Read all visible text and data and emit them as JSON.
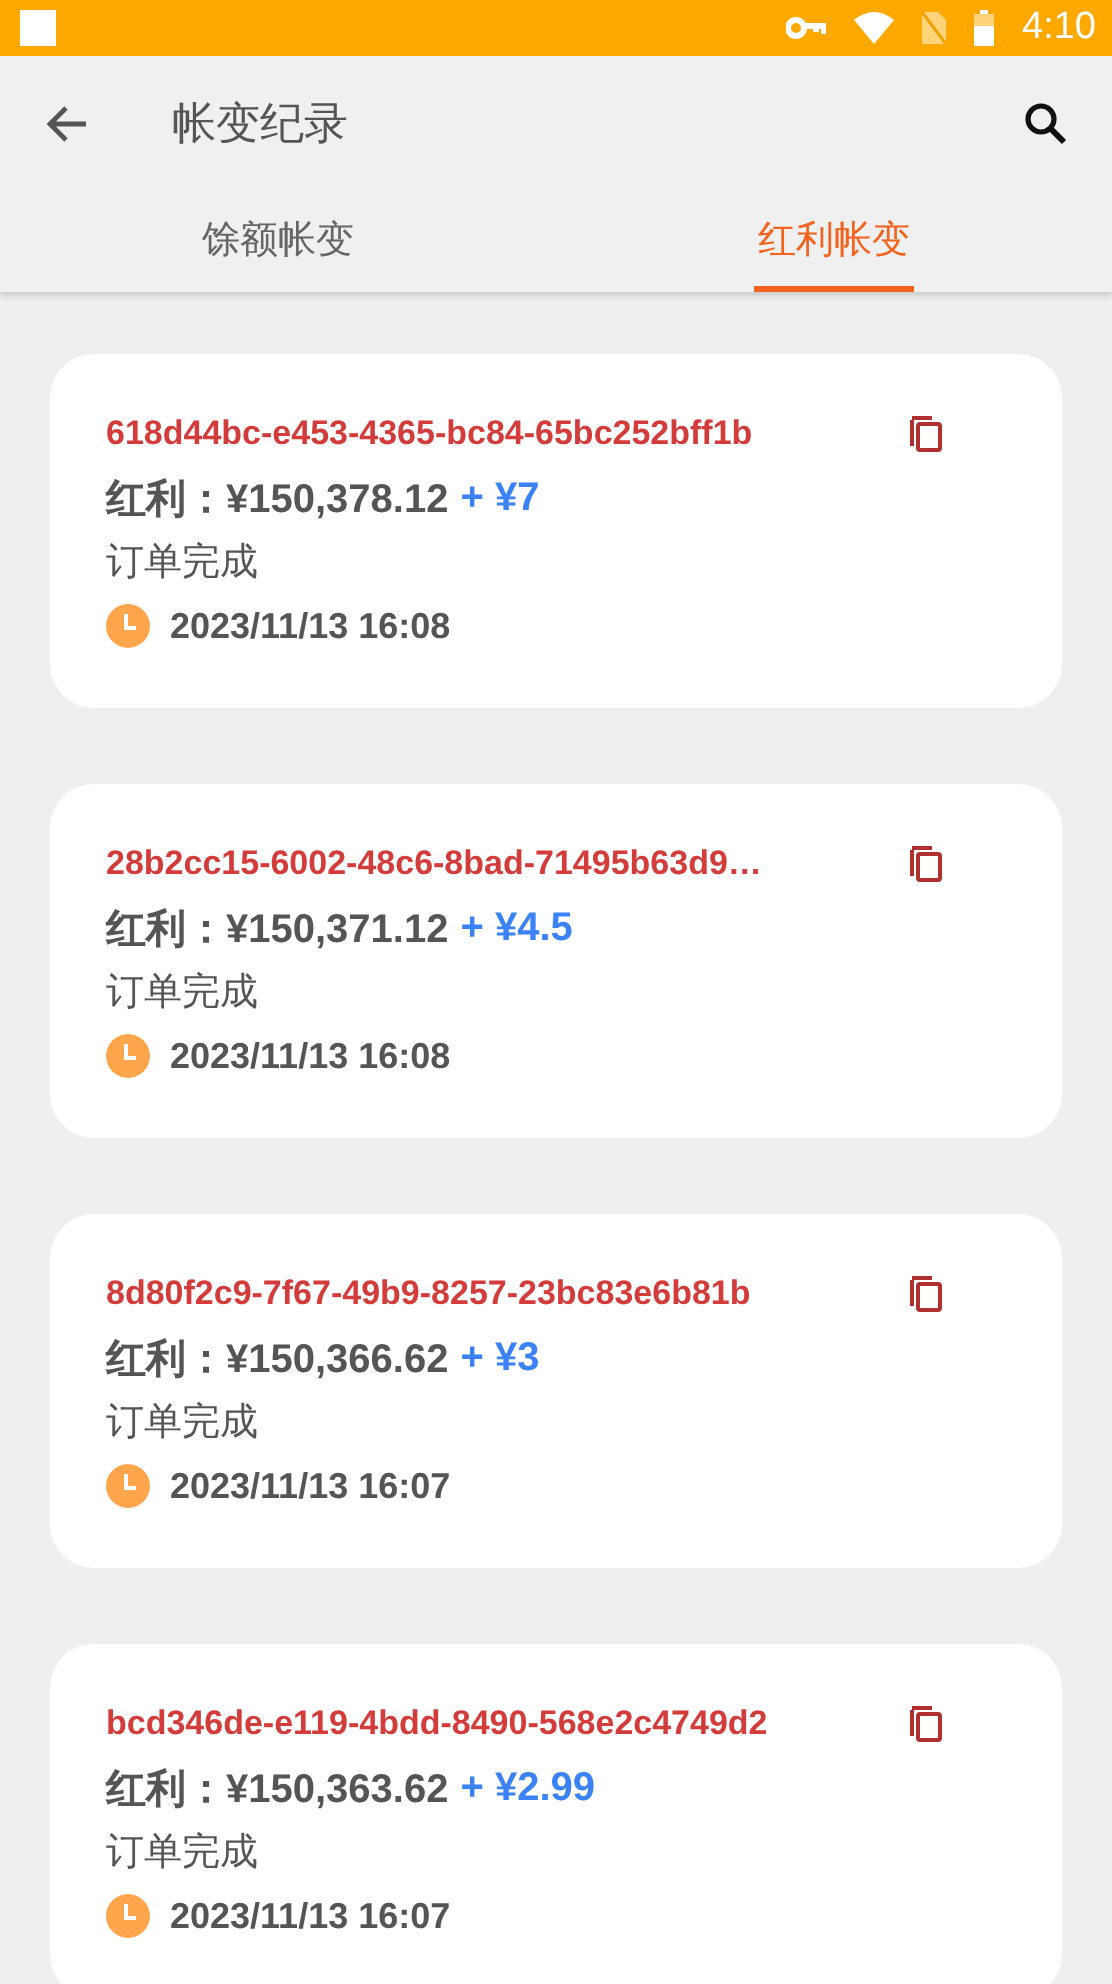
{
  "status_bar": {
    "time": "4:10"
  },
  "app_bar": {
    "title": "帐变纪录"
  },
  "tabs": [
    {
      "label": "馀额帐变",
      "selected": false
    },
    {
      "label": "红利帐变",
      "selected": true
    }
  ],
  "records": [
    {
      "id": "618d44bc-e453-4365-bc84-65bc252bff1b",
      "amount": "红利：¥150,378.12",
      "change": "+ ¥7",
      "status": "订单完成",
      "time": "2023/11/13 16:08"
    },
    {
      "id": "28b2cc15-6002-48c6-8bad-71495b63d9…",
      "amount": "红利：¥150,371.12",
      "change": "+ ¥4.5",
      "status": "订单完成",
      "time": "2023/11/13 16:08"
    },
    {
      "id": "8d80f2c9-7f67-49b9-8257-23bc83e6b81b",
      "amount": "红利：¥150,366.62",
      "change": "+ ¥3",
      "status": "订单完成",
      "time": "2023/11/13 16:07"
    },
    {
      "id": "bcd346de-e119-4bdd-8490-568e2c4749d2",
      "amount": "红利：¥150,363.62",
      "change": "+ ¥2.99",
      "status": "订单完成",
      "time": "2023/11/13 16:07"
    }
  ]
}
